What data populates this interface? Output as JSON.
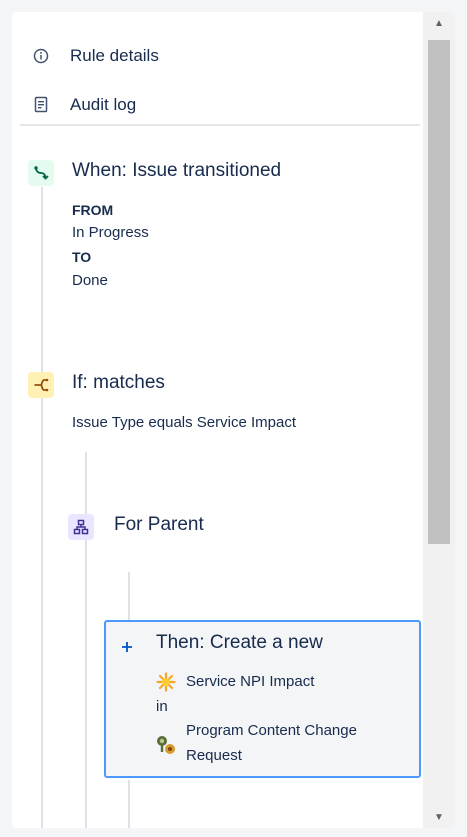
{
  "menu": {
    "rule_details": "Rule details",
    "audit_log": "Audit log"
  },
  "trigger": {
    "title": "When: Issue transitioned",
    "from_label": "FROM",
    "from_value": "In Progress",
    "to_label": "TO",
    "to_value": "Done",
    "icon": "transition-icon",
    "color": "#e3fcef"
  },
  "condition": {
    "title": "If: matches",
    "description": "Issue Type equals Service Impact",
    "icon": "branch-icon",
    "color": "#fff0b3"
  },
  "branch": {
    "title": "For Parent",
    "icon": "hierarchy-icon",
    "color": "#eae6ff"
  },
  "action": {
    "title": "Then: Create a new",
    "issue_type": "Service NPI Impact",
    "in_label": "in",
    "project_line1": "Program Content Change",
    "project_line2": "Request",
    "icon": "plus-icon",
    "accent": "#4c9aff"
  }
}
